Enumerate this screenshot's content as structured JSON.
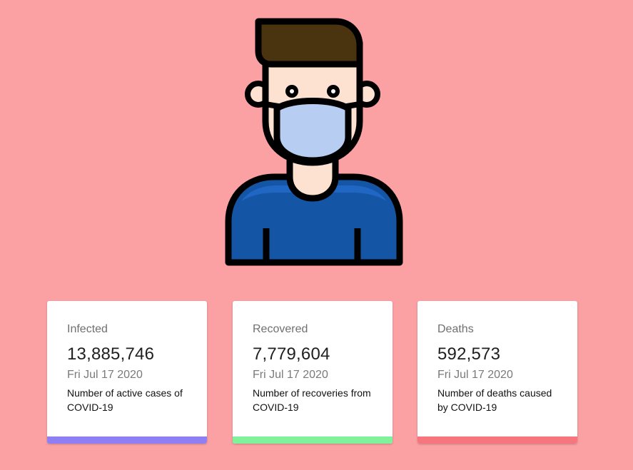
{
  "hero": {
    "icon": "masked-person-icon",
    "colors": {
      "hair": "#4a3410",
      "skin": "#fde2d2",
      "mask": "#b7cdf1",
      "shirt": "#1456a5",
      "shirt_highlight": "#1f67c2",
      "outline": "#000000"
    }
  },
  "cards": [
    {
      "title": "Infected",
      "value": "13,885,746",
      "date": "Fri Jul 17 2020",
      "description": "Number of active cases of COVID-19",
      "accent": "#8f7ff4"
    },
    {
      "title": "Recovered",
      "value": "7,779,604",
      "date": "Fri Jul 17 2020",
      "description": "Number of recoveries from COVID-19",
      "accent": "#7ff29b"
    },
    {
      "title": "Deaths",
      "value": "592,573",
      "date": "Fri Jul 17 2020",
      "description": "Number of deaths caused by COVID-19",
      "accent": "#f7767d"
    }
  ]
}
